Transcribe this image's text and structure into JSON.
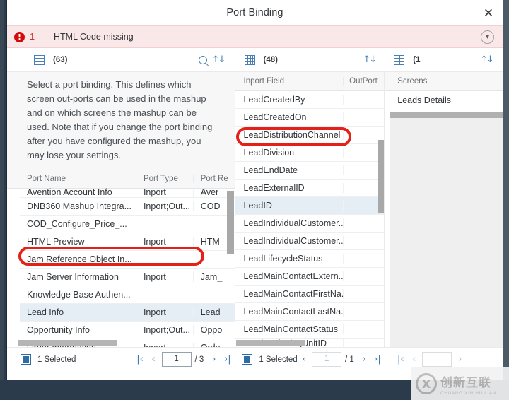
{
  "window": {
    "title": "Port Binding",
    "close_icon": "close-icon"
  },
  "message_strip": {
    "icon": "error-icon",
    "count": "1",
    "text": "HTML Code missing",
    "expand_icon": "chevron-down-circle-icon"
  },
  "toolbar": {
    "left": {
      "grid_icon": "table-icon",
      "count": "(63)",
      "search_icon": "search-icon",
      "sort_icon": "sort-icon"
    },
    "middle": {
      "grid_icon": "table-icon",
      "count": "(48)",
      "sort_icon": "sort-icon"
    },
    "right": {
      "grid_icon": "table-icon",
      "count": "(1",
      "sort_icon": "sort-icon"
    }
  },
  "left_panel": {
    "intro_text": "Select a port binding. This defines which screen out-ports can be used in the mashup and on which screens the mashup can be used. Note that if you change the port binding after you have configured the mashup, you may lose your settings.",
    "columns": [
      "Port Name",
      "Port Type",
      "Port Re"
    ],
    "rows": [
      {
        "name": "Avention Account Info",
        "type": "Inport",
        "ref": "Aver",
        "selected": false,
        "clipped_top": true
      },
      {
        "name": "DNB360 Mashup Integra...",
        "type": "Inport;Out...",
        "ref": "COD",
        "selected": false
      },
      {
        "name": "COD_Configure_Price_...",
        "type": "",
        "ref": "",
        "selected": false
      },
      {
        "name": "HTML Preview",
        "type": "Inport",
        "ref": "HTM",
        "selected": false
      },
      {
        "name": "Jam Reference Object In...",
        "type": "",
        "ref": "",
        "selected": false
      },
      {
        "name": "Jam Server Information",
        "type": "Inport",
        "ref": "Jam_",
        "selected": false
      },
      {
        "name": "Knowledge Base Authen...",
        "type": "",
        "ref": "",
        "selected": false
      },
      {
        "name": "Lead Info",
        "type": "Inport",
        "ref": "Lead",
        "selected": true
      },
      {
        "name": "Opportunity Info",
        "type": "Inport;Out...",
        "ref": "Oppo",
        "selected": false
      },
      {
        "name": "Order Information",
        "type": "Inport",
        "ref": "Orde",
        "selected": false
      }
    ]
  },
  "middle_panel": {
    "columns": [
      "Inport Field",
      "OutPort"
    ],
    "rows": [
      {
        "field": "LeadCreatedBy",
        "outport": "",
        "selected": false
      },
      {
        "field": "LeadCreatedOn",
        "outport": "",
        "selected": false
      },
      {
        "field": "LeadDistributionChannel",
        "outport": "",
        "selected": false
      },
      {
        "field": "LeadDivision",
        "outport": "",
        "selected": false
      },
      {
        "field": "LeadEndDate",
        "outport": "",
        "selected": false
      },
      {
        "field": "LeadExternalID",
        "outport": "",
        "selected": false
      },
      {
        "field": "LeadID",
        "outport": "",
        "selected": true
      },
      {
        "field": "LeadIndividualCustomer...",
        "outport": "",
        "selected": false
      },
      {
        "field": "LeadIndividualCustomer...",
        "outport": "",
        "selected": false
      },
      {
        "field": "LeadLifecycleStatus",
        "outport": "",
        "selected": false
      },
      {
        "field": "LeadMainContactExtern...",
        "outport": "",
        "selected": false
      },
      {
        "field": "LeadMainContactFirstNa...",
        "outport": "",
        "selected": false
      },
      {
        "field": "LeadMainContactLastNa...",
        "outport": "",
        "selected": false
      },
      {
        "field": "LeadMainContactStatus",
        "outport": "",
        "selected": false
      },
      {
        "field": "LeadMarketingUnitID",
        "outport": "",
        "selected": false,
        "clipped_bottom": true
      }
    ]
  },
  "right_panel": {
    "columns": [
      "Screens"
    ],
    "rows": [
      {
        "screen": "Leads Details",
        "selected": false
      }
    ]
  },
  "footer": {
    "left": {
      "selected_label": "1 Selected",
      "first_icon": "first-page-icon",
      "prev_icon": "prev-page-icon",
      "page_value": "1",
      "total": "/ 3",
      "next_icon": "next-page-icon",
      "last_icon": "last-page-icon"
    },
    "middle": {
      "selected_label": "1 Selected",
      "prev_icon": "prev-page-icon",
      "page_value": "1",
      "total": "/ 1",
      "next_icon": "next-page-icon",
      "last_icon": "last-page-icon"
    },
    "right": {
      "first_icon": "first-page-icon",
      "prev_icon": "prev-page-icon",
      "page_value": "",
      "total": "",
      "next_icon": "next-page-icon"
    }
  },
  "watermark": {
    "mark": "X",
    "cn": "创新互联",
    "py": "CHUANG XIN HU LIAN"
  },
  "colors": {
    "error_red": "#d20a0a",
    "error_bg": "#fae8e9",
    "accent_blue": "#4a7fb5",
    "selection_blue": "#2e6da4",
    "annotation_red": "#e32119",
    "row_selected_bg": "#e5eef5"
  }
}
